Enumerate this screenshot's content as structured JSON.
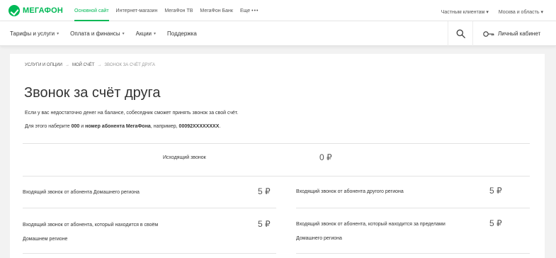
{
  "topbar": {
    "brand": "МЕГАФОН",
    "links": [
      {
        "label": "Основной сайт",
        "active": true
      },
      {
        "label": "Интернет-магазин",
        "active": false
      },
      {
        "label": "МегаФон ТВ",
        "active": false
      },
      {
        "label": "МегаФон Банк",
        "active": false
      },
      {
        "label": "Еще",
        "active": false
      }
    ],
    "more_dots": "•••",
    "segment": "Частным клиентам",
    "region": "Москва и область"
  },
  "nav": {
    "items": [
      {
        "label": "Тарифы и услуги",
        "dropdown": true
      },
      {
        "label": "Оплата и финансы",
        "dropdown": true
      },
      {
        "label": "Акции",
        "dropdown": true
      },
      {
        "label": "Поддержка",
        "dropdown": false
      }
    ],
    "cabinet": "Личный кабинет"
  },
  "breadcrumb": {
    "items": [
      "УСЛУГИ И ОПЦИИ",
      "МОЙ СЧЁТ",
      "ЗВОНОК ЗА СЧЁТ ДРУГА"
    ],
    "separator": "→"
  },
  "page": {
    "title": "Звонок за счёт друга",
    "description": "Если у вас недостаточно денег на балансе, собеседник сможет принять звонок за свой счёт.",
    "instruction_prefix": "Для этого наберите ",
    "instruction_code": "000",
    "instruction_mid": " и ",
    "instruction_bold": "номер абонента МегаФона",
    "instruction_example_prefix": ", например, ",
    "instruction_example": "00092XXXXXXXX",
    "instruction_end": "."
  },
  "tariffs": {
    "outgoing": {
      "label": "Исходящий звонок",
      "price": "0 ₽"
    },
    "home_region": {
      "label": "Входящий звонок от абонента Домашнего региона",
      "price": "5 ₽"
    },
    "other_region": {
      "label": "Входящий звонок от абонента другого региона",
      "price": "5 ₽"
    },
    "in_home": {
      "label_line1": "Входящий звонок от абонента, который находится в своём",
      "label_line2": "Домашнем регионе",
      "price": "5 ₽"
    },
    "outside_home": {
      "label_line1": "Входящий звонок от абонента, который находится за пределами",
      "label_line2": "Домашнего региона",
      "price": "5 ₽"
    }
  },
  "colors": {
    "brand_green": "#00b956",
    "text": "#333333",
    "muted": "#999999"
  }
}
